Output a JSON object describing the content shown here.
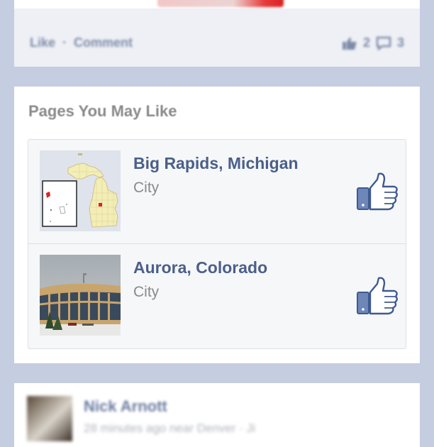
{
  "top_post": {
    "like_label": "Like",
    "separator": "·",
    "comment_label": "Comment",
    "like_count": "2",
    "comment_count": "3"
  },
  "pages_you_may_like": {
    "title": "Pages You May Like",
    "items": [
      {
        "name": "Big Rapids, Michigan",
        "type": "City",
        "thumbnail": "michigan-map",
        "like_icon": "thumbs-up-icon"
      },
      {
        "name": "Aurora, Colorado",
        "type": "City",
        "thumbnail": "building-photo",
        "like_icon": "thumbs-up-icon"
      }
    ]
  },
  "bottom_post": {
    "author": "Nick Arnott",
    "meta": "28 minutes ago near Denver · Ji"
  },
  "colors": {
    "background": "#c5cde0",
    "link_blue": "#4b5f89",
    "muted_text": "#8a8a8a",
    "like_icon_fill": "#6f86b8"
  }
}
